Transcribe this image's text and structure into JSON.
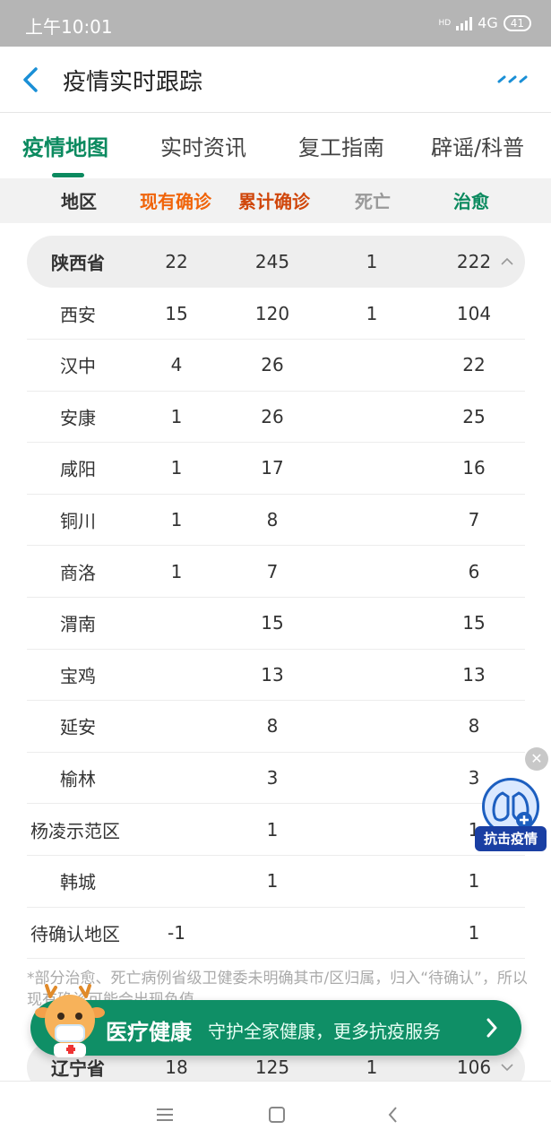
{
  "status_bar": {
    "time": "上午10:01",
    "network": "4G",
    "hd": "HD",
    "battery": "41"
  },
  "header": {
    "title": "疫情实时跟踪"
  },
  "tabs": [
    {
      "label": "疫情地图",
      "active": true
    },
    {
      "label": "实时资讯",
      "active": false
    },
    {
      "label": "复工指南",
      "active": false
    },
    {
      "label": "辟谣/科普",
      "active": false
    }
  ],
  "columns": {
    "region": "地区",
    "current": "现有确诊",
    "total": "累计确诊",
    "death": "死亡",
    "cured": "治愈"
  },
  "colors": {
    "accent": "#0b8a5f",
    "current": "#f0640a",
    "total": "#d0470c",
    "death": "#999999",
    "cured": "#0b8a5f"
  },
  "province": {
    "name": "陕西省",
    "current": "22",
    "total": "245",
    "death": "1",
    "cured": "222",
    "expanded": true
  },
  "cities": [
    {
      "name": "西安",
      "current": "15",
      "total": "120",
      "death": "1",
      "cured": "104"
    },
    {
      "name": "汉中",
      "current": "4",
      "total": "26",
      "death": "",
      "cured": "22"
    },
    {
      "name": "安康",
      "current": "1",
      "total": "26",
      "death": "",
      "cured": "25"
    },
    {
      "name": "咸阳",
      "current": "1",
      "total": "17",
      "death": "",
      "cured": "16"
    },
    {
      "name": "铜川",
      "current": "1",
      "total": "8",
      "death": "",
      "cured": "7"
    },
    {
      "name": "商洛",
      "current": "1",
      "total": "7",
      "death": "",
      "cured": "6"
    },
    {
      "name": "渭南",
      "current": "",
      "total": "15",
      "death": "",
      "cured": "15"
    },
    {
      "name": "宝鸡",
      "current": "",
      "total": "13",
      "death": "",
      "cured": "13"
    },
    {
      "name": "延安",
      "current": "",
      "total": "8",
      "death": "",
      "cured": "8"
    },
    {
      "name": "榆林",
      "current": "",
      "total": "3",
      "death": "",
      "cured": "3"
    },
    {
      "name": "杨凌示范区",
      "current": "",
      "total": "1",
      "death": "",
      "cured": "1"
    },
    {
      "name": "韩城",
      "current": "",
      "total": "1",
      "death": "",
      "cured": "1"
    },
    {
      "name": "待确认地区",
      "current": "-1",
      "total": "",
      "death": "",
      "cured": "1"
    }
  ],
  "note": "*部分治愈、死亡病例省级卫健委未明确其市/区归属，归入“待确认”，所以现有确诊可能会出现负值。",
  "next_province": {
    "name": "辽宁省",
    "current": "18",
    "total": "125",
    "death": "1",
    "cured": "106",
    "expanded": false
  },
  "health_banner": {
    "title": "医疗健康",
    "subtitle": "守护全家健康，更多抗疫服务"
  },
  "float_badge": {
    "label": "抗击疫情"
  }
}
